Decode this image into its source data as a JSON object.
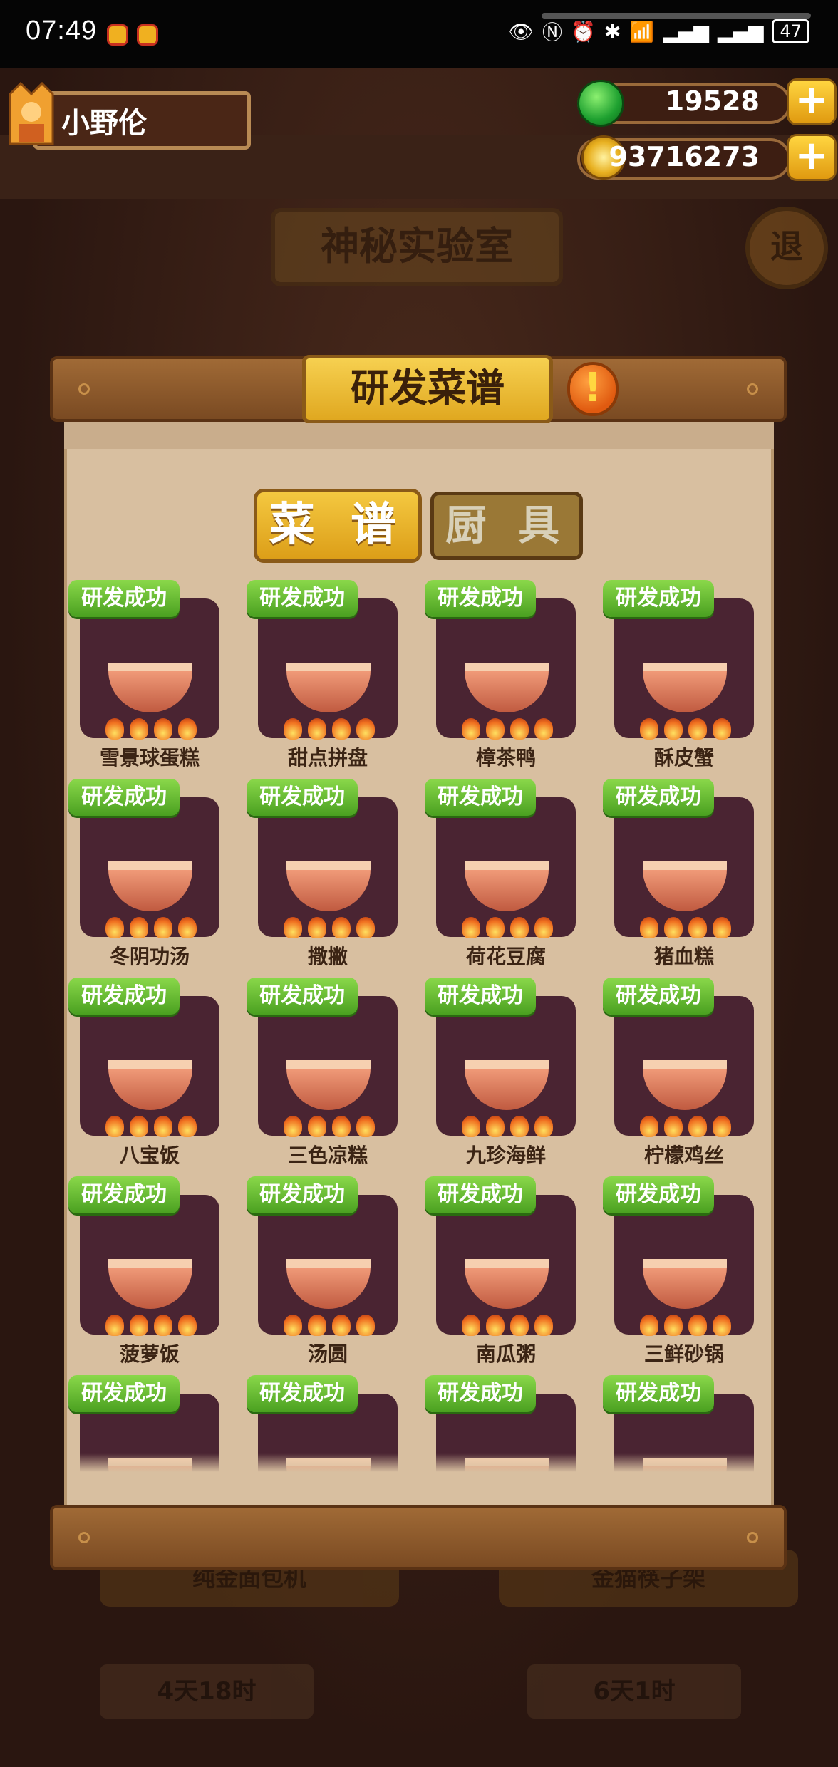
{
  "status_bar": {
    "time": "07:49",
    "battery": "47"
  },
  "player": {
    "name": "小野伦"
  },
  "currencies": {
    "jade": "19528",
    "coins": "93716273"
  },
  "background": {
    "lab_title": "神秘实验室",
    "exit_label": "退",
    "machines": [
      "纯金面包机",
      "金猫筷子架"
    ],
    "timers": [
      "4天18时",
      "6天1时"
    ]
  },
  "panel": {
    "title": "研发菜谱",
    "info_icon": "!",
    "tabs": [
      {
        "label": "菜 谱",
        "active": true
      },
      {
        "label": "厨 具",
        "active": false
      }
    ]
  },
  "recipes": [
    {
      "status": "研发成功",
      "name": "雪景球蛋糕"
    },
    {
      "status": "研发成功",
      "name": "甜点拼盘"
    },
    {
      "status": "研发成功",
      "name": "樟茶鸭"
    },
    {
      "status": "研发成功",
      "name": "酥皮蟹"
    },
    {
      "status": "研发成功",
      "name": "冬阴功汤"
    },
    {
      "status": "研发成功",
      "name": "撒撇"
    },
    {
      "status": "研发成功",
      "name": "荷花豆腐"
    },
    {
      "status": "研发成功",
      "name": "猪血糕"
    },
    {
      "status": "研发成功",
      "name": "八宝饭"
    },
    {
      "status": "研发成功",
      "name": "三色凉糕"
    },
    {
      "status": "研发成功",
      "name": "九珍海鲜"
    },
    {
      "status": "研发成功",
      "name": "柠檬鸡丝"
    },
    {
      "status": "研发成功",
      "name": "菠萝饭"
    },
    {
      "status": "研发成功",
      "name": "汤圆"
    },
    {
      "status": "研发成功",
      "name": "南瓜粥"
    },
    {
      "status": "研发成功",
      "name": "三鲜砂锅"
    },
    {
      "status": "研发成功",
      "name": ""
    },
    {
      "status": "研发成功",
      "name": ""
    },
    {
      "status": "研发成功",
      "name": ""
    },
    {
      "status": "研发成功",
      "name": ""
    }
  ],
  "colors": {
    "accent": "#f4c840",
    "badge": "#6cc038",
    "panel": "#d8bfa0",
    "card": "#4a2432"
  }
}
